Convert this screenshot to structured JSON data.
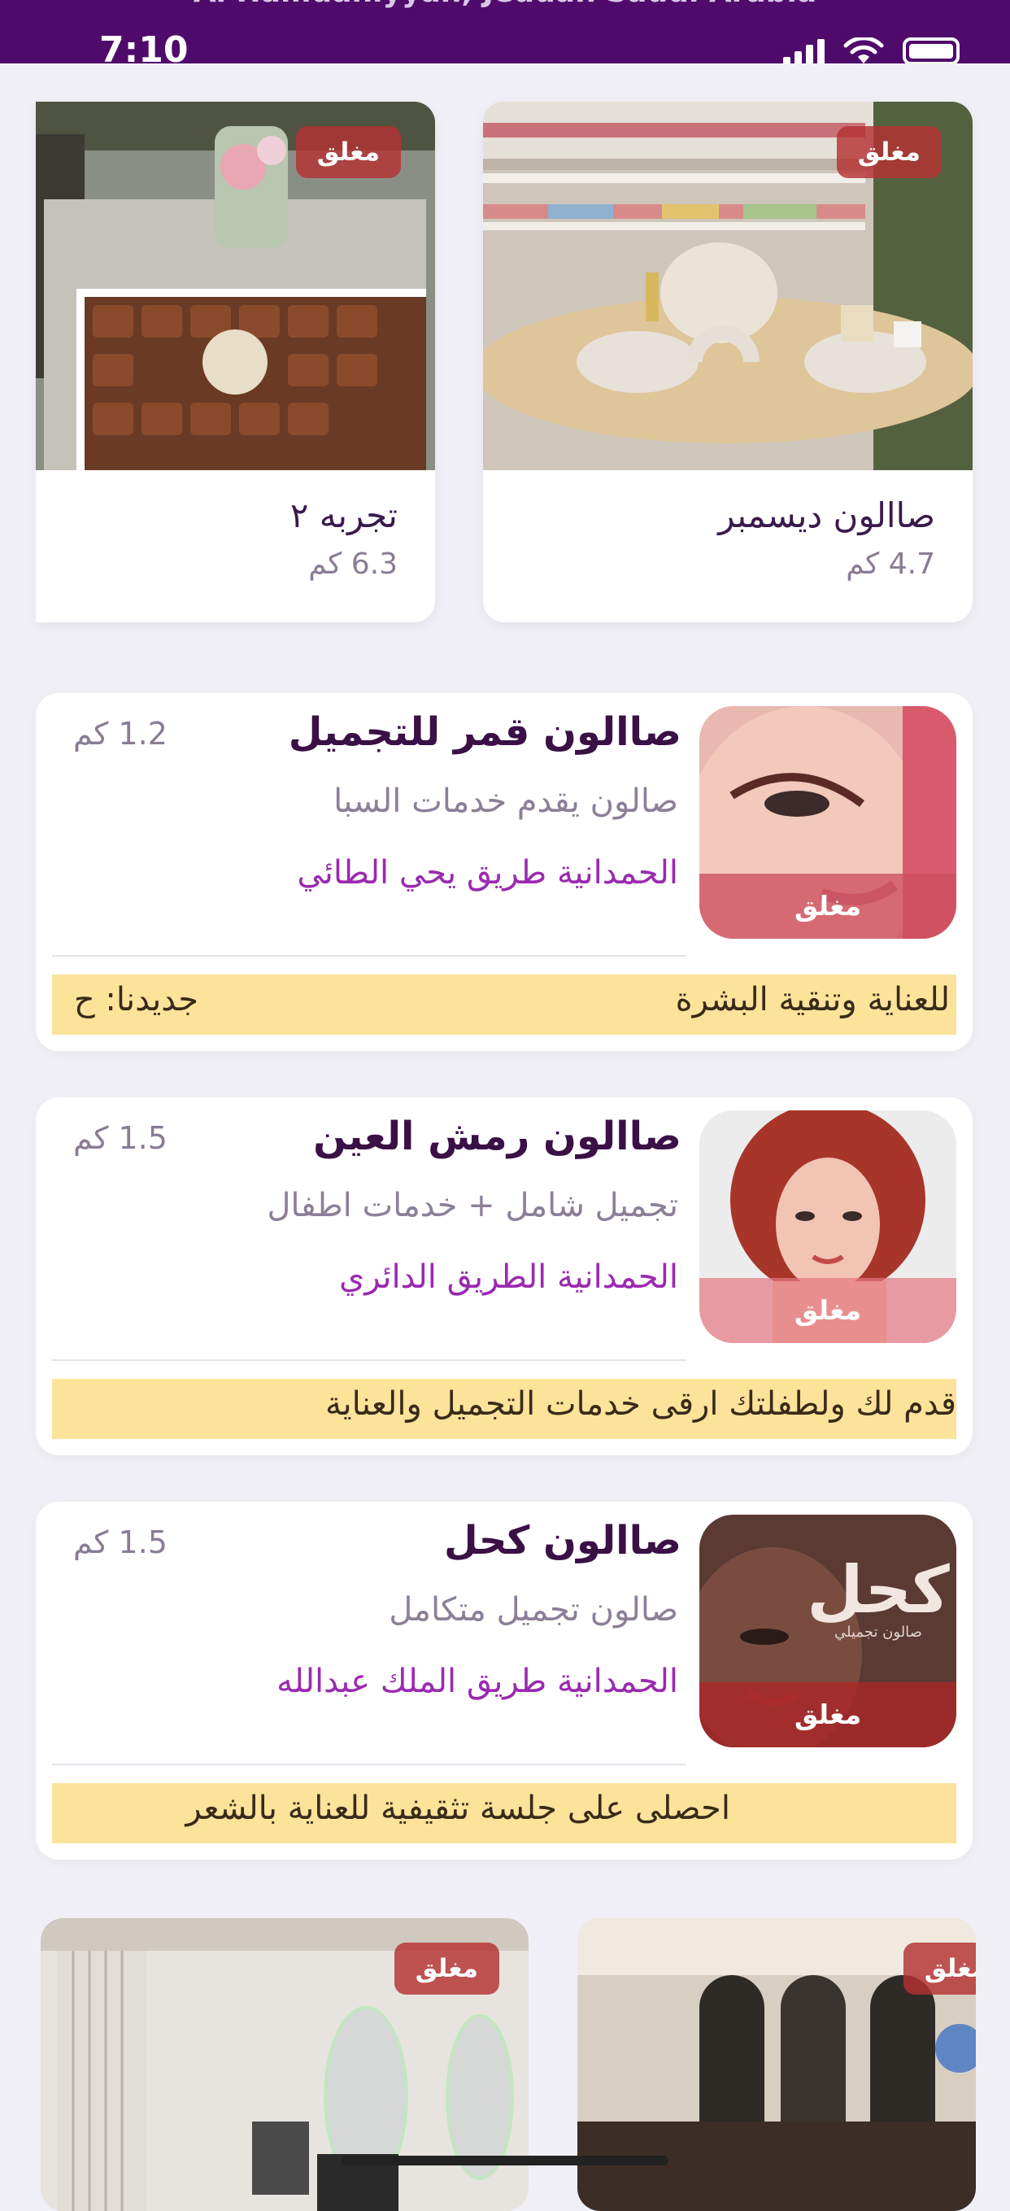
{
  "status_bar": {
    "location": "Al Hamdaniyyah, Jeddah Saudi Arabia",
    "time": "7:10",
    "colors": {
      "background": "#4f0b6b"
    }
  },
  "featured": [
    {
      "name": "صاالون ديسمبر",
      "distance": "4.7 كم",
      "status": "مغلق"
    },
    {
      "name": "تجربه ٢",
      "distance": "6.3 كم",
      "status": "مغلق"
    }
  ],
  "salons": [
    {
      "title": "صاالون قمر للتجميل",
      "distance": "1.2 كم",
      "description": "صالون يقدم خدمات السبا",
      "address": "الحمدانية طريق يحي الطائي",
      "status": "مغلق",
      "ticker": "للعناية وتنقية البشرة",
      "ticker_extra": "جديدنا: ح"
    },
    {
      "title": "صاالون رمش العين",
      "distance": "1.5 كم",
      "description": "تجميل شامل + خدمات اطفال",
      "address": "الحمدانية الطريق الدائري",
      "status": "مغلق",
      "ticker": "قدم لك ولطفلتك ارقى خدمات التجميل والعناية"
    },
    {
      "title": "صاالون كحل",
      "distance": "1.5 كم",
      "description": "صالون تجميل متكامل",
      "address": "الحمدانية طريق الملك عبدالله",
      "status": "مغلق",
      "ticker": "احصلى على جلسة تثقيفية للعناية بالشعر",
      "logo_text": "كحل",
      "logo_subtitle": "صالون تجميلي"
    }
  ],
  "bottom_row": [
    {
      "status": "مغلق"
    },
    {
      "status": "مغلق"
    }
  ],
  "colors": {
    "accent": "#4f0b6b",
    "address": "#9a2ab0",
    "ticker_bg": "#fbe39a",
    "closed_tag": "#b43232"
  }
}
